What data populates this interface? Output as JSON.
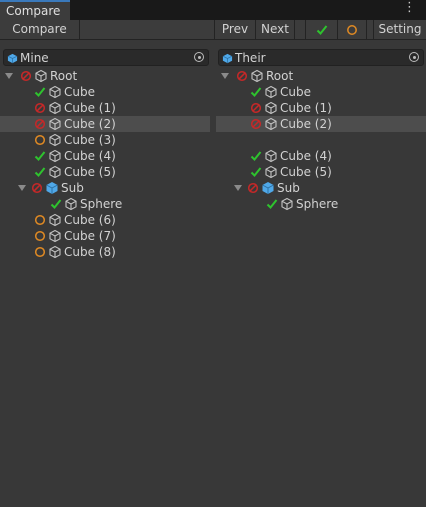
{
  "window": {
    "tab_title": "Compare",
    "menu_icon": "kebab-menu-icon"
  },
  "toolbar": {
    "compare_label": "Compare",
    "prev_label": "Prev",
    "next_label": "Next",
    "filter_ok_icon": "check-icon",
    "filter_changed_icon": "circle-icon",
    "setting_label": "Setting"
  },
  "colors": {
    "ok": "#2ec32e",
    "changed": "#e08a23",
    "missing": "#c62828",
    "prefab": "#4fa8e8",
    "selected_row": "#4d4d4d"
  },
  "left": {
    "object_field": "Mine",
    "rows": [
      {
        "name": "Root",
        "status": "missing",
        "icon": "gameobject-icon",
        "expanded": true,
        "selected": false
      },
      {
        "name": "Cube",
        "status": "ok",
        "icon": "gameobject-icon",
        "selected": false
      },
      {
        "name": "Cube (1)",
        "status": "missing",
        "icon": "gameobject-icon",
        "selected": false
      },
      {
        "name": "Cube (2)",
        "status": "missing",
        "icon": "gameobject-icon",
        "selected": true
      },
      {
        "name": "Cube (3)",
        "status": "changed",
        "icon": "gameobject-icon",
        "selected": false
      },
      {
        "name": "Cube (4)",
        "status": "ok",
        "icon": "gameobject-icon",
        "selected": false
      },
      {
        "name": "Cube (5)",
        "status": "ok",
        "icon": "gameobject-icon",
        "selected": false
      },
      {
        "name": "Sub",
        "status": "missing",
        "icon": "prefab-icon",
        "expanded": true,
        "selected": false
      },
      {
        "name": "Sphere",
        "status": "ok",
        "icon": "gameobject-icon",
        "selected": false
      },
      {
        "name": "Cube (6)",
        "status": "changed",
        "icon": "gameobject-icon",
        "selected": false
      },
      {
        "name": "Cube (7)",
        "status": "changed",
        "icon": "gameobject-icon",
        "selected": false
      },
      {
        "name": "Cube (8)",
        "status": "changed",
        "icon": "gameobject-icon",
        "selected": false
      }
    ]
  },
  "right": {
    "object_field": "Their",
    "rows": [
      {
        "name": "Root",
        "status": "missing",
        "icon": "gameobject-icon",
        "expanded": true,
        "selected": false
      },
      {
        "name": "Cube",
        "status": "ok",
        "icon": "gameobject-icon",
        "selected": false
      },
      {
        "name": "Cube (1)",
        "status": "missing",
        "icon": "gameobject-icon",
        "selected": false
      },
      {
        "name": "Cube (2)",
        "status": "missing",
        "icon": "gameobject-icon",
        "selected": true
      },
      null,
      {
        "name": "Cube (4)",
        "status": "ok",
        "icon": "gameobject-icon",
        "selected": false
      },
      {
        "name": "Cube (5)",
        "status": "ok",
        "icon": "gameobject-icon",
        "selected": false
      },
      {
        "name": "Sub",
        "status": "missing",
        "icon": "prefab-icon",
        "expanded": true,
        "selected": false
      },
      {
        "name": "Sphere",
        "status": "ok",
        "icon": "gameobject-icon",
        "selected": false
      }
    ]
  }
}
